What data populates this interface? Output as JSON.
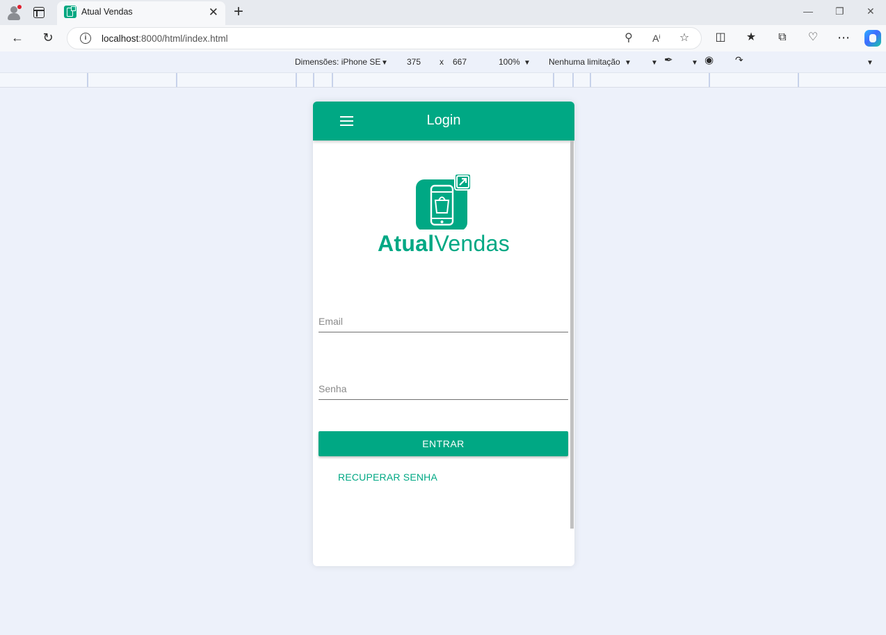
{
  "browser": {
    "tab_title": "Atual Vendas",
    "tab_close": "✕",
    "new_tab": "+",
    "url_host": "localhost",
    "url_rest": ":8000/html/index.html",
    "window": {
      "minimize": "—",
      "restore": "❐",
      "close": "✕"
    }
  },
  "device_toolbar": {
    "dimensions": "Dimensões: iPhone SE",
    "width": "375",
    "times": "x",
    "height": "667",
    "zoom": "100%",
    "throttling": "Nenhuma limitação"
  },
  "app": {
    "title": "Login",
    "brand_bold": "Atual",
    "brand_light": "Vendas",
    "email_placeholder": "Email",
    "password_placeholder": "Senha",
    "enter_button": "ENTRAR",
    "recover_link": "RECUPERAR SENHA"
  },
  "colors": {
    "brand": "#00a884",
    "page_bg": "#edf1fa"
  }
}
